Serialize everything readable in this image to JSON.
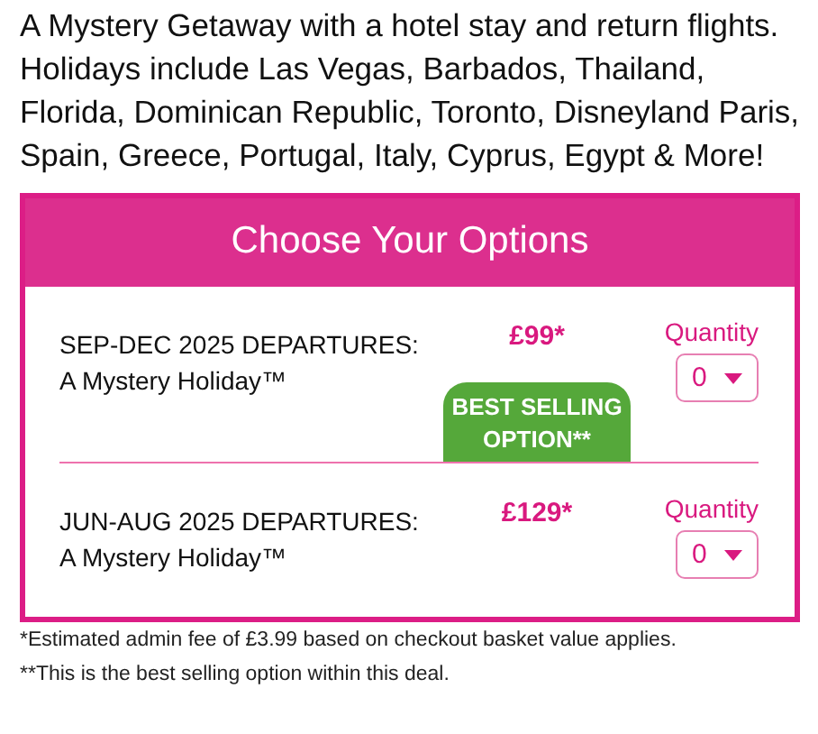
{
  "intro": "A Mystery Getaway with a hotel stay and return flights. Holidays include Las Vegas, Barbados, Thailand, Florida, Dominican Republic, Toronto, Disneyland Paris, Spain, Greece, Portugal, Italy, Cyprus, Egypt & More!",
  "options": {
    "title": "Choose Your Options",
    "rows": [
      {
        "departures": "SEP-DEC 2025 DEPARTURES:",
        "name": "A Mystery Holiday™",
        "price": "£99*",
        "badge": "BEST SELLING OPTION**",
        "quantity_label": "Quantity",
        "quantity": "0"
      },
      {
        "departures": "JUN-AUG 2025 DEPARTURES:",
        "name": "A Mystery Holiday™",
        "price": "£129*",
        "quantity_label": "Quantity",
        "quantity": "0"
      }
    ]
  },
  "footnotes": [
    "*Estimated admin fee of £3.99 based on checkout basket value applies.",
    "**This is the best selling option within this deal."
  ]
}
